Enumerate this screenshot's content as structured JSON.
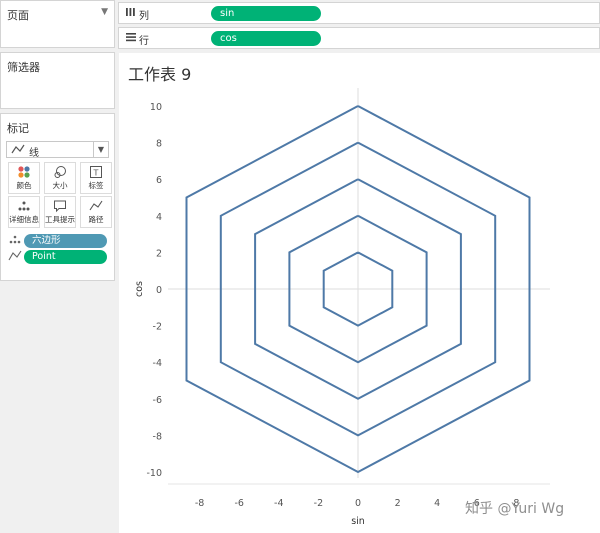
{
  "pages_panel": {
    "title": "页面"
  },
  "filters_panel": {
    "title": "筛选器"
  },
  "marks_panel": {
    "title": "标记",
    "mark_type": "线",
    "buttons": [
      {
        "label": "颜色",
        "icon": "color-dots-icon"
      },
      {
        "label": "大小",
        "icon": "size-icon"
      },
      {
        "label": "标签",
        "icon": "label-icon"
      },
      {
        "label": "详细信息",
        "icon": "detail-icon"
      },
      {
        "label": "工具提示",
        "icon": "tooltip-icon"
      },
      {
        "label": "路径",
        "icon": "path-icon"
      }
    ],
    "fields": [
      {
        "name": "六边形",
        "color": "#4f99b4",
        "icon": "detail-dots-icon"
      },
      {
        "name": "Point",
        "color": "#00b276",
        "icon": "path-line-icon"
      }
    ]
  },
  "shelves": {
    "columns": {
      "label": "列",
      "pill": "sin"
    },
    "rows": {
      "label": "行",
      "pill": "cos"
    }
  },
  "sheet": {
    "title": "工作表 9"
  },
  "watermark": "知乎 @Yuri Wg",
  "chart_data": {
    "type": "line",
    "xlabel": "sin",
    "ylabel": "cos",
    "xlim": [
      -10,
      10
    ],
    "ylim": [
      -11,
      11
    ],
    "xticks": [
      -8,
      -6,
      -4,
      -2,
      0,
      2,
      4,
      6,
      8
    ],
    "yticks": [
      -10,
      -8,
      -6,
      -4,
      -2,
      0,
      2,
      4,
      6,
      8,
      10
    ],
    "color": "#4e79a7",
    "series": [
      {
        "points": [
          [
            0,
            2
          ],
          [
            1.732,
            1
          ],
          [
            1.732,
            -1
          ],
          [
            0,
            -2
          ],
          [
            -1.732,
            -1
          ],
          [
            -1.732,
            1
          ],
          [
            0,
            2
          ]
        ]
      },
      {
        "points": [
          [
            0,
            4
          ],
          [
            3.464,
            2
          ],
          [
            3.464,
            -2
          ],
          [
            0,
            -4
          ],
          [
            -3.464,
            -2
          ],
          [
            -3.464,
            2
          ],
          [
            0,
            4
          ]
        ]
      },
      {
        "points": [
          [
            0,
            6
          ],
          [
            5.196,
            3
          ],
          [
            5.196,
            -3
          ],
          [
            0,
            -6
          ],
          [
            -5.196,
            -3
          ],
          [
            -5.196,
            3
          ],
          [
            0,
            6
          ]
        ]
      },
      {
        "points": [
          [
            0,
            8
          ],
          [
            6.928,
            4
          ],
          [
            6.928,
            -4
          ],
          [
            0,
            -8
          ],
          [
            -6.928,
            -4
          ],
          [
            -6.928,
            4
          ],
          [
            0,
            8
          ]
        ]
      },
      {
        "points": [
          [
            0,
            10
          ],
          [
            8.66,
            5
          ],
          [
            8.66,
            -5
          ],
          [
            0,
            -10
          ],
          [
            -8.66,
            -5
          ],
          [
            -8.66,
            5
          ],
          [
            0,
            10
          ]
        ]
      }
    ]
  }
}
